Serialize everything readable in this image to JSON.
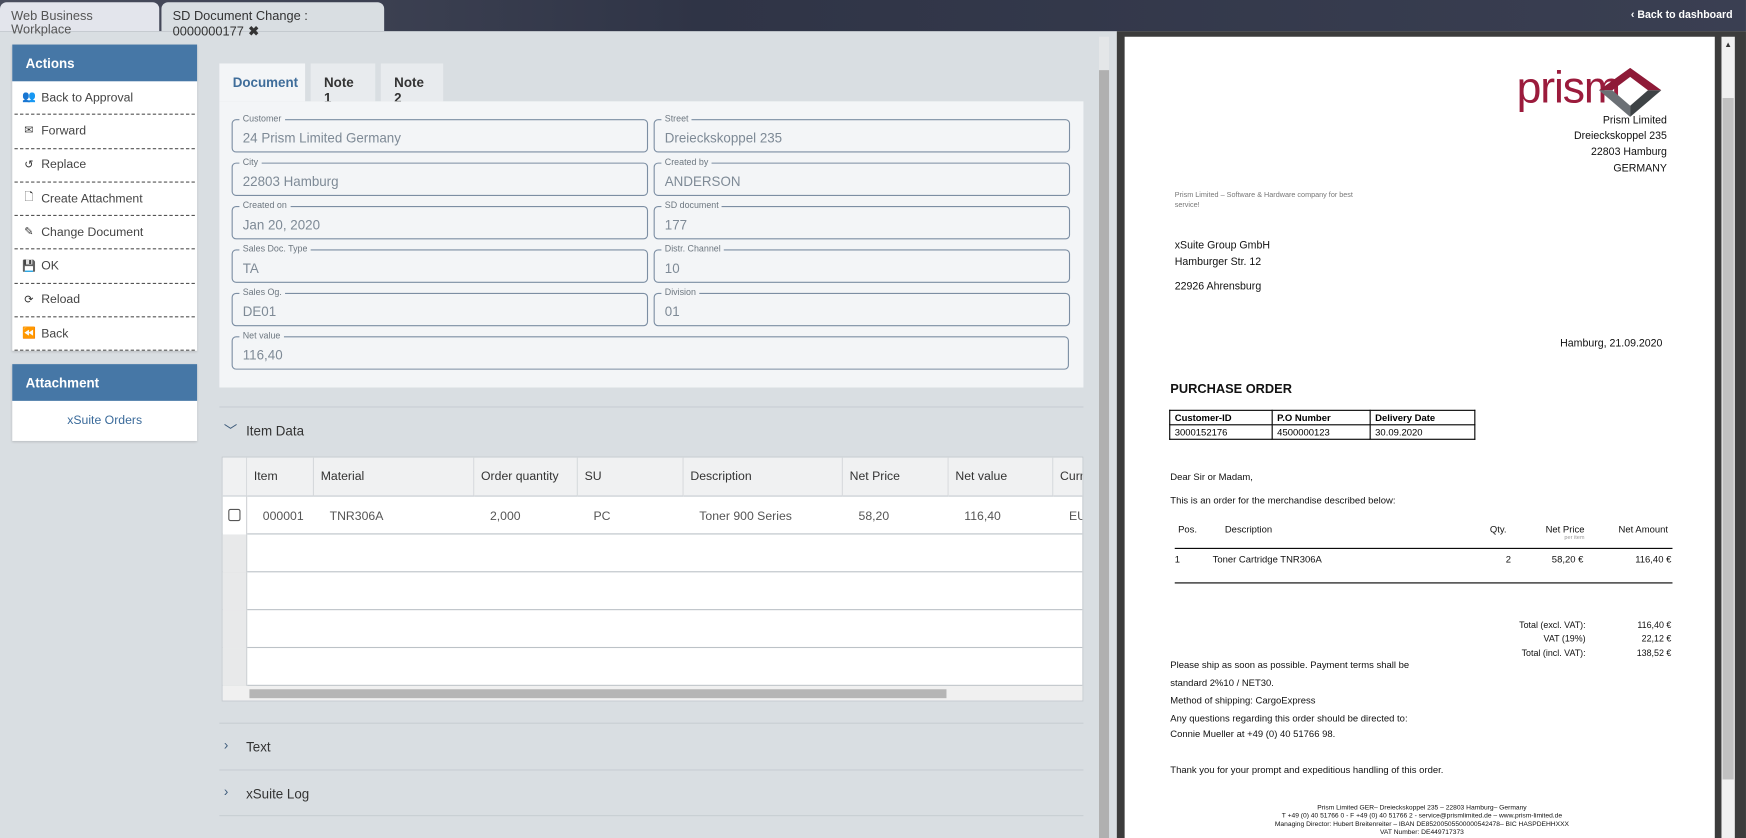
{
  "tabs": [
    {
      "label": "Web Business Workplace"
    },
    {
      "label": "SD Document Change : 0000000177",
      "close": "✖"
    }
  ],
  "back_to_dashboard": "Back to dashboard",
  "actions": {
    "title": "Actions",
    "items": [
      {
        "label": "Back to Approval",
        "icon": "users-icon"
      },
      {
        "label": "Forward",
        "icon": "envelope-icon"
      },
      {
        "label": "Replace",
        "icon": "undo-icon"
      },
      {
        "label": "Create Attachment",
        "icon": "file-icon"
      },
      {
        "label": "Change Document",
        "icon": "pencil-icon"
      },
      {
        "label": "OK",
        "icon": "save-icon"
      },
      {
        "label": "Reload",
        "icon": "refresh-icon"
      },
      {
        "label": "Back",
        "icon": "backward-icon"
      }
    ]
  },
  "attachment": {
    "title": "Attachment",
    "item": "xSuite Orders"
  },
  "doc_tabs": [
    "Document",
    "Note 1",
    "Note 2"
  ],
  "fields": [
    {
      "label": "Customer",
      "value": "24 Prism Limited Germany"
    },
    {
      "label": "Street",
      "value": "Dreieckskoppel 235"
    },
    {
      "label": "City",
      "value": "22803 Hamburg"
    },
    {
      "label": "Created by",
      "value": "ANDERSON"
    },
    {
      "label": "Created on",
      "value": "Jan 20, 2020"
    },
    {
      "label": "SD document",
      "value": "177"
    },
    {
      "label": "Sales Doc. Type",
      "value": "TA"
    },
    {
      "label": "Distr. Channel",
      "value": "10"
    },
    {
      "label": "Sales Og.",
      "value": "DE01"
    },
    {
      "label": "Division",
      "value": "01"
    },
    {
      "label": "Net value",
      "value": "116,40"
    }
  ],
  "sections": {
    "item_data": "Item Data",
    "text": "Text",
    "log": "xSuite Log"
  },
  "grid": {
    "columns": [
      "Item",
      "Material",
      "Order quantity",
      "SU",
      "Description",
      "Net Price",
      "Net value",
      "Curr"
    ],
    "rows": [
      [
        "000001",
        "TNR306A",
        "2,000",
        "PC",
        "Toner 900 Series",
        "58,20",
        "116,40",
        "EU"
      ]
    ]
  },
  "pdf": {
    "logo_text": "prism",
    "sender": [
      "Prism Limited",
      "Dreieckskoppel 235",
      "22803 Hamburg",
      "GERMANY"
    ],
    "tagline": [
      "Prism Limited – Software & Hardware company for best",
      "service!"
    ],
    "recipient": [
      "xSuite Group GmbH",
      "Hamburger Str. 12",
      "22926 Ahrensburg"
    ],
    "date": "Hamburg, 21.09.2020",
    "title": "PURCHASE ORDER",
    "info_headers": [
      "Customer-ID",
      "P.O Number",
      "Delivery Date"
    ],
    "info_values": [
      "3000152176",
      "4500000123",
      "30.09.2020"
    ],
    "greeting": "Dear Sir or Madam,",
    "intro": "This is an order for the merchandise described below:",
    "item_headers": {
      "pos": "Pos.",
      "desc": "Description",
      "qty": "Qty.",
      "price": "Net Price",
      "price_sub": "per item",
      "amount": "Net Amount"
    },
    "item": {
      "pos": "1",
      "desc": "Toner Cartridge TNR306A",
      "qty": "2",
      "price": "58,20 €",
      "amount": "116,40 €"
    },
    "totals": [
      {
        "label": "Total (excl. VAT):",
        "value": "116,40 €"
      },
      {
        "label": "VAT (19%)",
        "value": "22,12 €"
      },
      {
        "label": "Total (incl. VAT):",
        "value": "138,52 €"
      }
    ],
    "body": [
      "Please ship as soon as possible. Payment terms shall be",
      "standard 2%10 / NET30.",
      "Method of shipping: CargoExpress",
      "Any questions regarding this order should be directed to:",
      "Connie Mueller at +49 (0) 40 51766 98."
    ],
    "thanks": "Thank you for your prompt and expeditious handling of this order.",
    "footer": [
      "Prism Limited GER– Dreieckskoppel 235 – 22803 Hamburg– Germany",
      "T +49 (0) 40 51766 0 - F +49 (0) 40 51766 2 - service@prismlimited.de – www.prism-limited.de",
      "Managing Director: Hubert Breitenreiter – IBAN DE85200505500000542478– BIC HASPDEHHXXX",
      "VAT Number: DE449717373"
    ]
  },
  "colors": {
    "accent": "#4677a6",
    "brand": "#9b1b3c"
  }
}
